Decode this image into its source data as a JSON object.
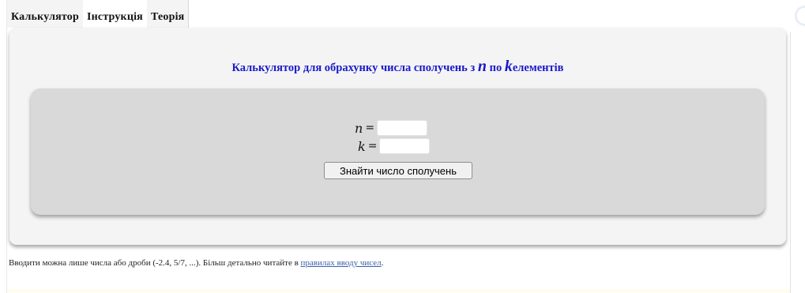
{
  "tabs": [
    {
      "label": "Калькулятор"
    },
    {
      "label": "Інструкція"
    },
    {
      "label": "Теорія"
    }
  ],
  "panel": {
    "title_prefix": "Калькулятор для обрахунку числа сполучень з",
    "title_var_n": "n",
    "title_middle": "по",
    "title_var_k": "k",
    "title_suffix": "елементів"
  },
  "form": {
    "n_label": "n",
    "k_label": "k",
    "equals": "=",
    "n_value": "",
    "k_value": "",
    "submit_label": "Знайти число сполучень"
  },
  "footer": {
    "text": "Вводити можна лише числа або дроби (-2.4, 5/7, ...). Більш детально читайте в",
    "link_label": "правилах вводу чисел",
    "trailing": "."
  },
  "colors": {
    "title": "#1a1acc",
    "panel_bg": "#f4f4f4",
    "inner_bg": "#d9d9d9",
    "link": "#3b5fa8"
  }
}
